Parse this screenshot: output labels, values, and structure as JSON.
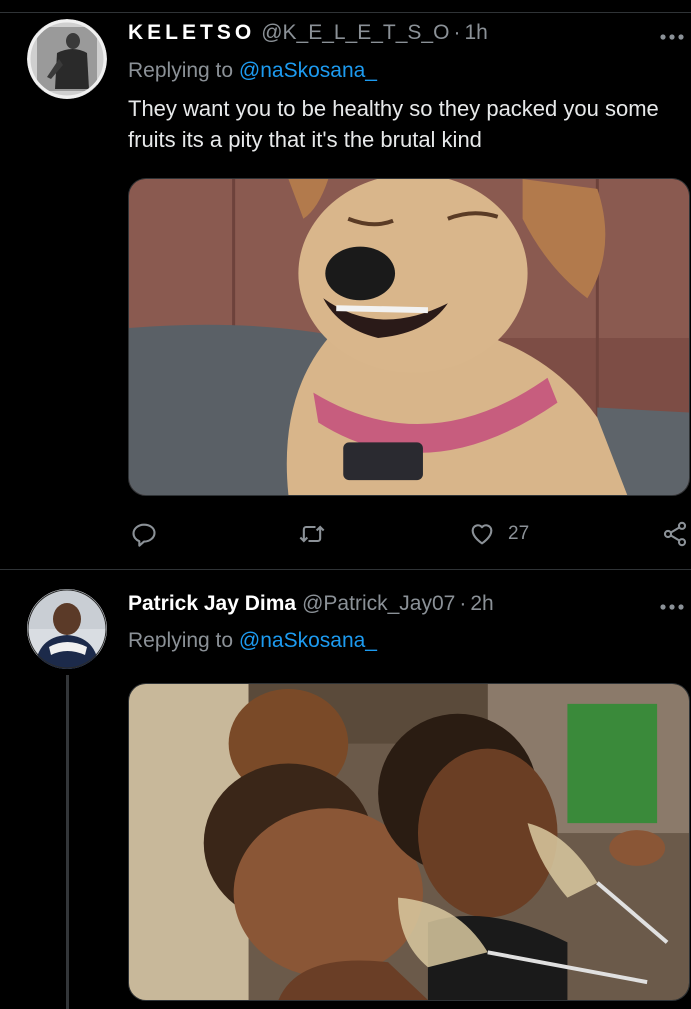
{
  "theme": {
    "background": "#000000",
    "divider": "#2f3336",
    "secondary_text": "#8b9197",
    "link": "#1d9bf0",
    "primary_text": "#e7e9ea"
  },
  "tweets": [
    {
      "display_name": "KELETSO",
      "handle": "@K_E_L_E_T_S_O",
      "separator": "·",
      "time": "1h",
      "replying_prefix": "Replying to",
      "replying_to": "@naSkosana_",
      "text": "They want you to be healthy so they packed you some fruits its a pity that it's the brutal kind",
      "media_description": "photo-smiling-dog-with-pink-collar",
      "actions": {
        "reply_icon": "reply-icon",
        "retweet_icon": "retweet-icon",
        "like_icon": "heart-icon",
        "like_count": "27",
        "share_icon": "share-icon"
      },
      "more_icon": "more-horizontal-icon"
    },
    {
      "display_name": "Patrick Jay Dima",
      "handle": "@Patrick_Jay07",
      "separator": "·",
      "time": "2h",
      "replying_prefix": "Replying to",
      "replying_to": "@naSkosana_",
      "media_description": "photo-two-women-drinking-champagne",
      "more_icon": "more-horizontal-icon"
    }
  ]
}
